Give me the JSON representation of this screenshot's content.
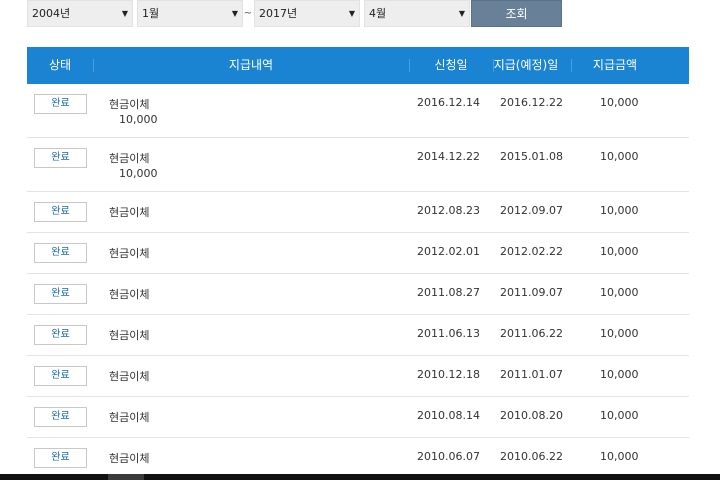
{
  "filters": {
    "start_year": "2004년",
    "start_month": "1월",
    "separator": "~",
    "end_year": "2017년",
    "end_month": "4월",
    "search_label": "조회"
  },
  "table": {
    "headers": [
      "상태",
      "지급내역",
      "신청일",
      "지급(예정)일",
      "지급금액"
    ],
    "rows": [
      {
        "status": "완료",
        "desc": "현금이체",
        "sub_amount": "10,000",
        "apply_date": "2016.12.14",
        "pay_date": "2016.12.22",
        "amount": "10,000"
      },
      {
        "status": "완료",
        "desc": "현금이체",
        "sub_amount": "10,000",
        "apply_date": "2014.12.22",
        "pay_date": "2015.01.08",
        "amount": "10,000"
      },
      {
        "status": "완료",
        "desc": "현금이체",
        "apply_date": "2012.08.23",
        "pay_date": "2012.09.07",
        "amount": "10,000"
      },
      {
        "status": "완료",
        "desc": "현금이체",
        "apply_date": "2012.02.01",
        "pay_date": "2012.02.22",
        "amount": "10,000"
      },
      {
        "status": "완료",
        "desc": "현금이체",
        "apply_date": "2011.08.27",
        "pay_date": "2011.09.07",
        "amount": "10,000"
      },
      {
        "status": "완료",
        "desc": "현금이체",
        "apply_date": "2011.06.13",
        "pay_date": "2011.06.22",
        "amount": "10,000"
      },
      {
        "status": "완료",
        "desc": "현금이체",
        "apply_date": "2010.12.18",
        "pay_date": "2011.01.07",
        "amount": "10,000"
      },
      {
        "status": "완료",
        "desc": "현금이체",
        "apply_date": "2010.08.14",
        "pay_date": "2010.08.20",
        "amount": "10,000"
      },
      {
        "status": "완료",
        "desc": "현금이체",
        "apply_date": "2010.06.07",
        "pay_date": "2010.06.22",
        "amount": "10,000"
      }
    ]
  },
  "colors": {
    "header_bg": "#1a84d2",
    "search_btn_bg": "#688098",
    "badge_text": "#1a6aa8"
  }
}
